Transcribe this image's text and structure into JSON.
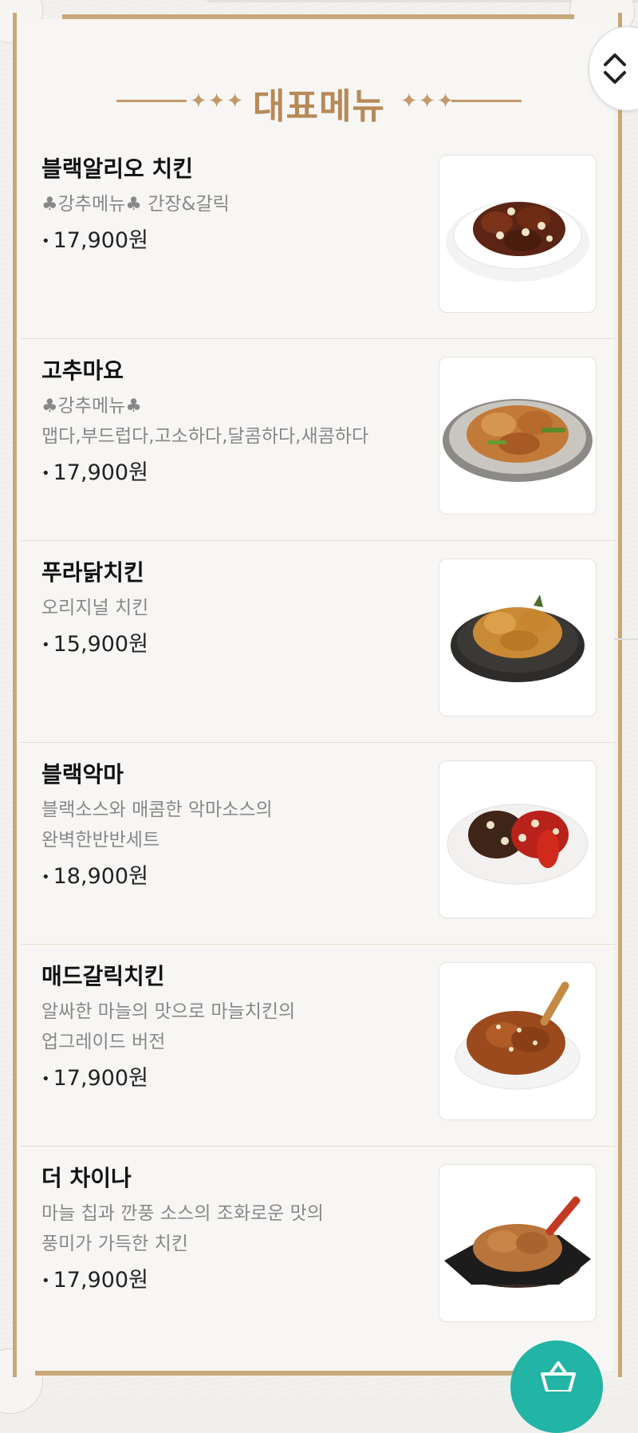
{
  "section": {
    "title": "대표메뉴"
  },
  "colors": {
    "frame": "#c8a77a",
    "title": "#b68a58",
    "cart": "#22b4a4"
  },
  "icons": {
    "scroll": "chevron-up-down-icon",
    "cart": "shopping-basket-icon"
  },
  "menu": [
    {
      "name": "블랙알리오 치킨",
      "desc1": "♣강추메뉴♣ 간장&갈릭",
      "desc2": "",
      "price": "17,900원"
    },
    {
      "name": "고추마요",
      "desc1": "♣강추메뉴♣",
      "desc2": "맵다,부드럽다,고소하다,달콤하다,새콤하다",
      "price": "17,900원"
    },
    {
      "name": "푸라닭치킨",
      "desc1": "오리지널 치킨",
      "desc2": "",
      "price": "15,900원"
    },
    {
      "name": "블랙악마",
      "desc1": "블랙소스와 매콤한 악마소스의",
      "desc2": "완벽한반반세트",
      "price": "18,900원"
    },
    {
      "name": "매드갈릭치킨",
      "desc1": "알싸한 마늘의 맛으로 마늘치킨의",
      "desc2": "업그레이드 버전",
      "price": "17,900원"
    },
    {
      "name": "더 차이나",
      "desc1": "마늘 칩과 깐풍 소스의 조화로운 맛의",
      "desc2": "풍미가 가득한 치킨",
      "price": "17,900원"
    }
  ]
}
